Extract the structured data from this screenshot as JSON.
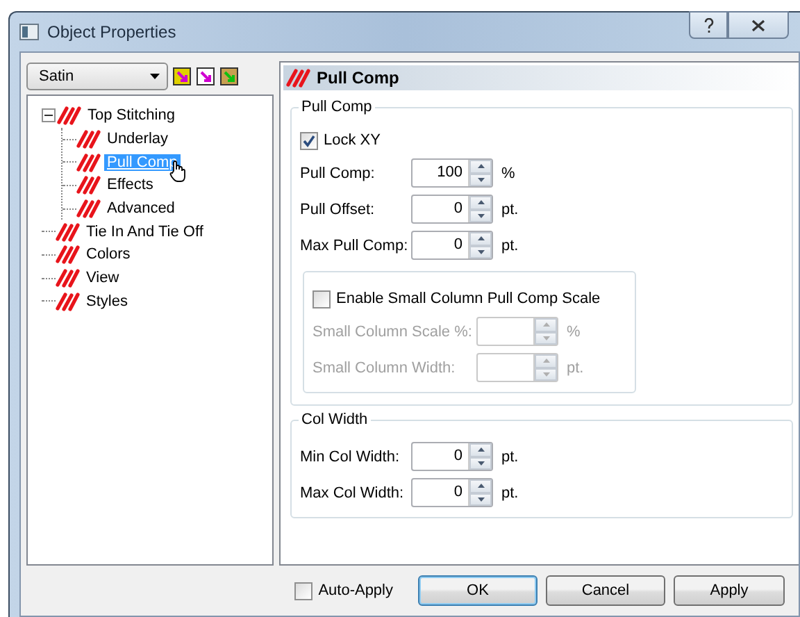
{
  "window": {
    "title": "Object Properties"
  },
  "left": {
    "dropdown": {
      "value": "Satin"
    },
    "tree": [
      {
        "label": "Top Stitching",
        "selected": false,
        "expanded": true,
        "children": [
          {
            "label": "Underlay",
            "selected": false
          },
          {
            "label": "Pull Comp",
            "selected": true
          },
          {
            "label": "Effects",
            "selected": false
          },
          {
            "label": "Advanced",
            "selected": false
          }
        ]
      },
      {
        "label": "Tie In And Tie Off",
        "selected": false
      },
      {
        "label": "Colors",
        "selected": false
      },
      {
        "label": "View",
        "selected": false
      },
      {
        "label": "Styles",
        "selected": false
      }
    ]
  },
  "right": {
    "header": "Pull Comp",
    "groups": [
      {
        "title": "Pull Comp",
        "items": [
          {
            "kind": "checkbox",
            "label": "Lock XY",
            "checked": true
          },
          {
            "kind": "spin",
            "label": "Pull Comp:",
            "value": "100",
            "unit": "%",
            "disabled": false
          },
          {
            "kind": "spin",
            "label": "Pull Offset:",
            "value": "0",
            "unit": "pt.",
            "disabled": false
          },
          {
            "kind": "spin",
            "label": "Max Pull Comp:",
            "value": "0",
            "unit": "pt.",
            "disabled": false
          },
          {
            "kind": "subgroup",
            "items": [
              {
                "kind": "checkbox",
                "label": "Enable Small Column Pull Comp Scale",
                "checked": false
              },
              {
                "kind": "spin",
                "label": "Small Column Scale %:",
                "unit": "%",
                "disabled": true
              },
              {
                "kind": "spin",
                "label": "Small Column Width:",
                "unit": "pt.",
                "disabled": true
              }
            ]
          }
        ]
      },
      {
        "title": "Col Width",
        "items": [
          {
            "kind": "spin",
            "label": "Min Col Width:",
            "value": "0",
            "unit": "pt.",
            "disabled": false
          },
          {
            "kind": "spin",
            "label": "Max Col Width:",
            "value": "0",
            "unit": "pt.",
            "disabled": false
          }
        ]
      }
    ]
  },
  "footer": {
    "auto_apply": {
      "label": "Auto-Apply",
      "checked": false
    },
    "buttons": [
      {
        "label": "OK",
        "default": true
      },
      {
        "label": "Cancel",
        "default": false
      },
      {
        "label": "Apply",
        "default": false
      }
    ]
  }
}
